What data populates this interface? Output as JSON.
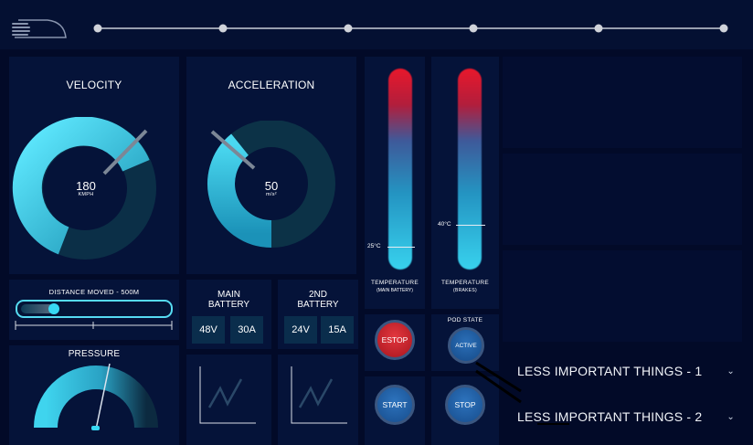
{
  "velocity": {
    "title": "VELOCITY",
    "value": "180",
    "unit": "KMPH"
  },
  "acceleration": {
    "title": "ACCELERATION",
    "value": "50",
    "unit": "m/s²"
  },
  "distance": {
    "label": "DISTANCE MOVED - 500M",
    "progress": 0.12
  },
  "pressure": {
    "title": "PRESSURE"
  },
  "main_battery": {
    "title_line1": "MAIN",
    "title_line2": "BATTERY",
    "voltage": "48V",
    "current": "30A"
  },
  "second_battery": {
    "title_line1": "2ND",
    "title_line2": "BATTERY",
    "voltage": "24V",
    "current": "15A"
  },
  "temp_main": {
    "reading": "25°C",
    "label_line1": "TEMPERATURE",
    "label_line2": "(MAIN BATTERY)"
  },
  "temp_brakes": {
    "reading": "40°C",
    "label_line1": "TEMPERATURE",
    "label_line2": "(BRAKES)"
  },
  "pod_state": {
    "label": "POD STATE",
    "value": "ACTIVE"
  },
  "buttons": {
    "estop": "ESTOP",
    "start": "START",
    "stop": "STOP"
  },
  "accordion": [
    {
      "label": "LESS IMPORTANT THINGS - 1"
    },
    {
      "label": "LESS IMPORTANT THINGS - 2"
    }
  ],
  "colors": {
    "background": "#020a28",
    "panel": "#051339",
    "accent_cyan": "#37d8f3",
    "estop_red": "#c8202a",
    "button_blue": "#1d5fa6"
  },
  "icons": {
    "menu": "menu-icon",
    "pod_logo": "pod-logo-icon",
    "chevron": "chevron-down-icon"
  }
}
